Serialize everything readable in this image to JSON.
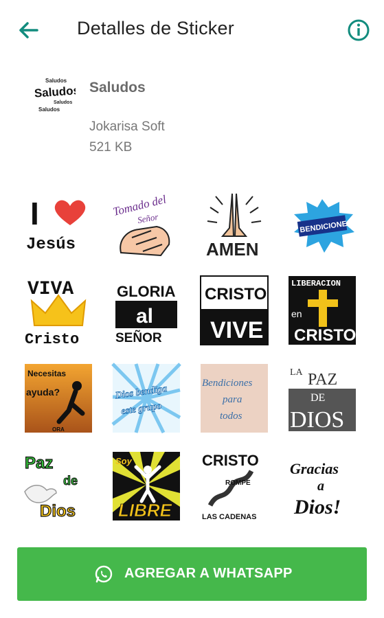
{
  "header": {
    "title": "Detalles de Sticker",
    "back_icon": "arrow-back-icon",
    "info_icon": "info-icon",
    "accent": "#128c7e"
  },
  "pack": {
    "icon_lines": [
      "Saludos",
      "Saludos",
      "Saludos",
      "Saludos"
    ],
    "name": "Saludos",
    "author": "Jokarisa Soft",
    "size": "521 KB"
  },
  "stickers": [
    {
      "lines": [
        "I",
        "Jesús"
      ]
    },
    {
      "lines": [
        "Tomado del",
        "Señor"
      ]
    },
    {
      "lines": [
        "AMEN"
      ]
    },
    {
      "lines": [
        "BENDICIONES"
      ]
    },
    {
      "lines": [
        "VIVA",
        "Cristo"
      ]
    },
    {
      "lines": [
        "GLORIA",
        "al",
        "SEÑOR"
      ]
    },
    {
      "lines": [
        "CRISTO",
        "VIVE"
      ]
    },
    {
      "lines": [
        "LIBERACION",
        "en",
        "CRISTO"
      ]
    },
    {
      "lines": [
        "Necesitas",
        "ayuda?",
        "ORA"
      ]
    },
    {
      "lines": [
        "Dios bendiga",
        "este grupo"
      ]
    },
    {
      "lines": [
        "Bendiciones",
        "para",
        "todos"
      ]
    },
    {
      "lines": [
        "LA",
        "PAZ",
        "DE",
        "DIOS"
      ]
    },
    {
      "lines": [
        "Paz",
        "de",
        "Dios"
      ]
    },
    {
      "lines": [
        "Soy",
        "LIBRE"
      ]
    },
    {
      "lines": [
        "CRISTO",
        "ROMPE",
        "LAS CADENAS"
      ]
    },
    {
      "lines": [
        "Gracias",
        "a",
        "Dios!"
      ]
    }
  ],
  "add_button": {
    "label": "AGREGAR A WHATSAPP",
    "icon": "whatsapp-icon",
    "color": "#45b84b"
  }
}
